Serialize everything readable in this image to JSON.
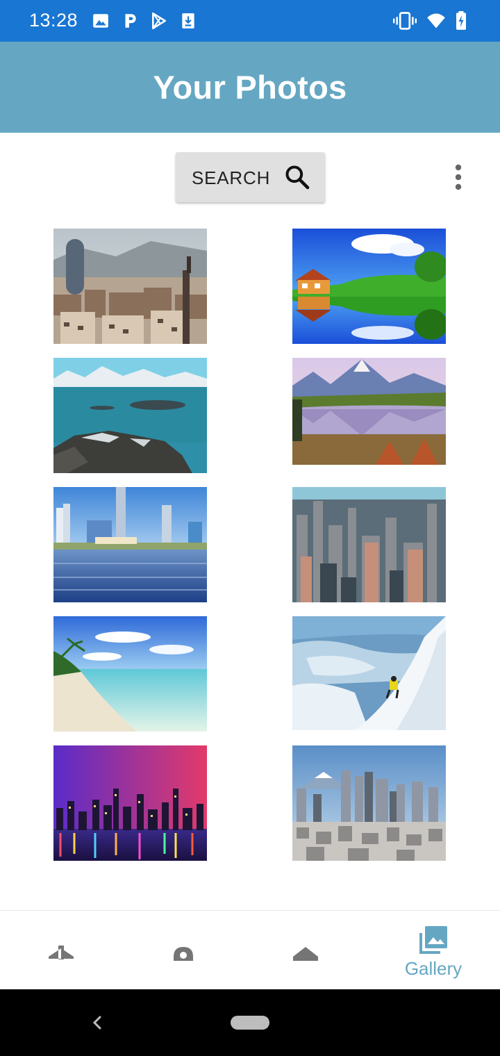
{
  "status_bar": {
    "time": "13:28",
    "left_icons": [
      "image-icon",
      "parking-icon",
      "play-store-icon",
      "download-icon"
    ],
    "right_icons": [
      "vibrate-icon",
      "wifi-icon",
      "battery-charging-icon"
    ]
  },
  "app_bar": {
    "title": "Your Photos"
  },
  "toolbar": {
    "search_label": "SEARCH"
  },
  "photos": [
    {
      "name": "barcelona-city"
    },
    {
      "name": "house-lake-reflection"
    },
    {
      "name": "arctic-fjord-rocks"
    },
    {
      "name": "mountain-lake-reflection"
    },
    {
      "name": "city-skyline-lake"
    },
    {
      "name": "chicago-aerial"
    },
    {
      "name": "tropical-beach"
    },
    {
      "name": "skier-mountain-fjord"
    },
    {
      "name": "night-city-skyline"
    },
    {
      "name": "tokyo-fuji-skyline"
    }
  ],
  "bottom_nav": {
    "items": [
      {
        "icon": "airplane-icon",
        "label": ""
      },
      {
        "icon": "place-icon",
        "label": ""
      },
      {
        "icon": "layers-icon",
        "label": ""
      },
      {
        "icon": "gallery-icon",
        "label": "Gallery"
      }
    ],
    "active_index": 3,
    "active_color": "#65a7c2",
    "inactive_color": "#757575"
  },
  "colors": {
    "status_bar": "#1976d2",
    "app_bar": "#65a7c2"
  }
}
